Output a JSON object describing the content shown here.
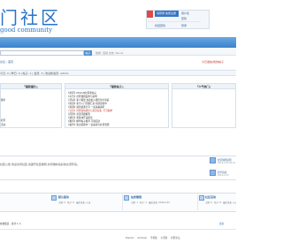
{
  "header": {
    "logo_text": "门社区",
    "logo_sub": "good community",
    "user": {
      "badge": "请登录·免费注册",
      "links": [
        "用户名",
        "密码"
      ],
      "extra": [
        "找回密码",
        "登录"
      ]
    }
  },
  "subbar": {
    "text": "快捷导航 · 门户 · 论坛 · 群组 · 家园 · 排行榜"
  },
  "search": {
    "placeholder": "请输入搜索内容",
    "button_label": "帖子",
    "hot": "热搜: 活动 交友 discuz"
  },
  "breadcrumb": "论坛 › 首页",
  "top_link": "今日发帖/我的帖子",
  "stats": "今日: 0 | 昨日: 0 | 帖子: 1 | 会员: 3 | 欢迎新会员: admin",
  "columns": {
    "left": {
      "title": "『最新图片』",
      "items": [
        "图片",
        "社区",
        "活动"
      ]
    },
    "middle": {
      "title": "『最新帖子』",
      "items": [
        {
          "text": "【社区】DISCUZ社区新帖子",
          "color": "red"
        },
        {
          "text": "【公告】社区规则发布与说明",
          "color": "blue"
        },
        {
          "text": "【活动】新人报到 欢迎加入我们的大家庭",
          "color": "blue"
        },
        {
          "text": "【交流】新手入门问题汇总 持续更新中",
          "color": "blue"
        },
        {
          "text": "【资源】最新资源分享 一起来看看吧",
          "color": "blue"
        },
        {
          "text": "【讨论】社区版块建议与意见征集 【已采纳】",
          "color": "red"
        },
        {
          "text": "【问答】常见问题解答",
          "color": "blue"
        },
        {
          "text": "【建议】新版块开设建议",
          "color": "blue"
        },
        {
          "text": "【推荐】精华帖子推荐 不容错过",
          "color": "blue"
        },
        {
          "text": "【站务】版主招募中 一起来参与社区管理",
          "color": "blue"
        }
      ]
    },
    "right": {
      "title": "『人气热门』",
      "items": []
    }
  },
  "announcement": {
    "text": "社区公告 欢迎访问社区,请遵守社区规则,共同维护良好的交流环境。",
    "right_link": "社区规则说明",
    "right_meta": "2019-2-23 20:41",
    "right_link2": "新手指南",
    "right_meta2": "2019-2-23"
  },
  "forums": [
    {
      "name": "默认版块",
      "meta": "主题: 0 · 帖子: 0 · 最后发表: 从未"
    },
    {
      "name": "站务管理",
      "meta": "主题: 1 · 帖子: 1 · 最后发表: 2019-2-23"
    },
    {
      "name": "社区活动",
      "meta": "主题: 0 · 帖子: 0 · 最后发表: 从未"
    }
  ],
  "small_row": {
    "left": "在线会员 - 总计 1 人",
    "right": "更多"
  },
  "footer": [
    "Discuz!",
    "Archiver",
    "手机版",
    "小黑屋",
    "社区论坛"
  ]
}
